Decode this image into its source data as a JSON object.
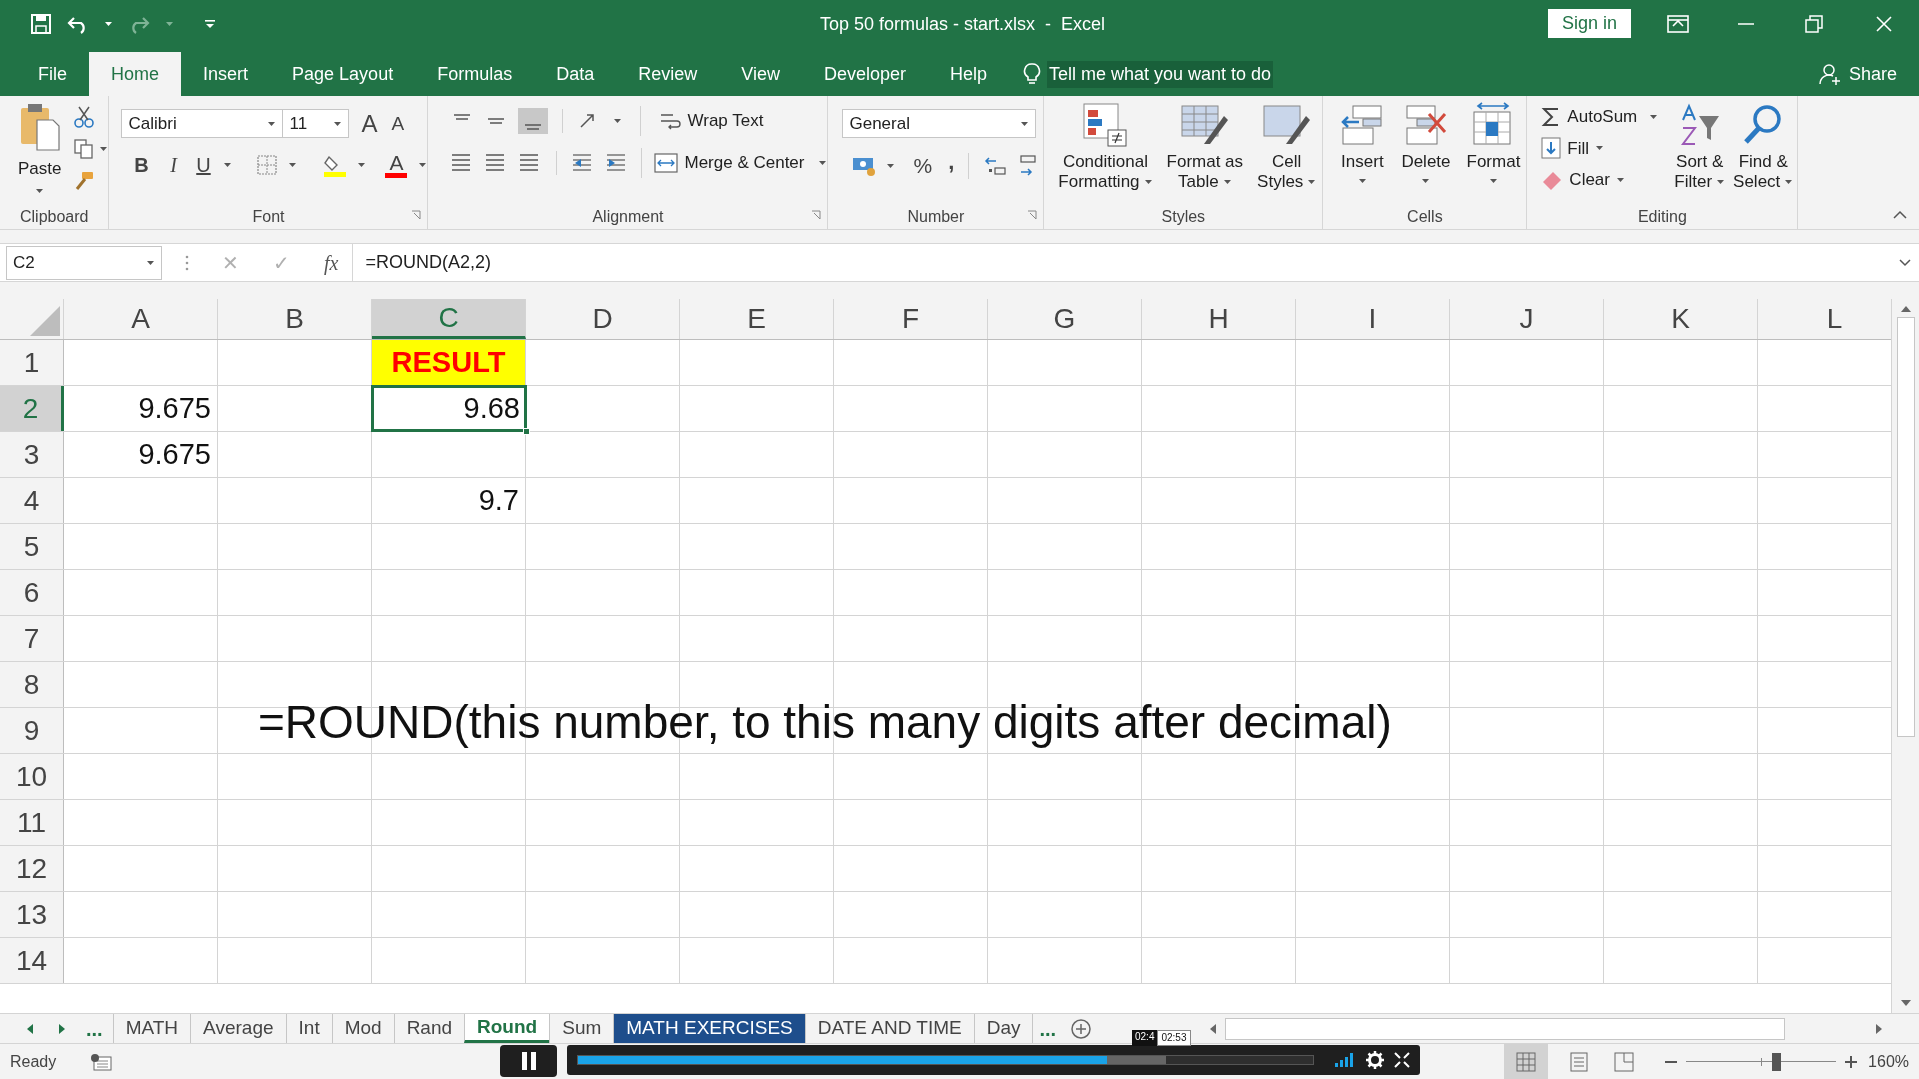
{
  "title_bar": {
    "title": "Top 50 formulas - start.xlsx  -  Excel",
    "sign_in": "Sign in"
  },
  "menu_tabs": [
    {
      "label": "File",
      "selected": false
    },
    {
      "label": "Home",
      "selected": true
    },
    {
      "label": "Insert",
      "selected": false
    },
    {
      "label": "Page Layout",
      "selected": false
    },
    {
      "label": "Formulas",
      "selected": false
    },
    {
      "label": "Data",
      "selected": false
    },
    {
      "label": "Review",
      "selected": false
    },
    {
      "label": "View",
      "selected": false
    },
    {
      "label": "Developer",
      "selected": false
    },
    {
      "label": "Help",
      "selected": false
    }
  ],
  "tell_me": "Tell me what you want to do",
  "share": "Share",
  "ribbon": {
    "clipboard": {
      "paste": "Paste",
      "label": "Clipboard"
    },
    "font": {
      "name": "Calibri",
      "size": "11",
      "grow": "A",
      "shrink": "A",
      "bold": "B",
      "italic": "I",
      "underline": "U",
      "color_letter": "A",
      "label": "Font"
    },
    "alignment": {
      "wrap_text": "Wrap Text",
      "merge": "Merge & Center",
      "label": "Alignment"
    },
    "number": {
      "format": "General",
      "percent": "%",
      "comma": ",",
      "label": "Number"
    },
    "styles": {
      "buttons": [
        {
          "lines": [
            "Conditional",
            "Formatting"
          ]
        },
        {
          "lines": [
            "Format as",
            "Table"
          ]
        },
        {
          "lines": [
            "Cell",
            "Styles"
          ]
        }
      ],
      "label": "Styles"
    },
    "cells": {
      "buttons": [
        {
          "lines": [
            "Insert"
          ]
        },
        {
          "lines": [
            "Delete"
          ]
        },
        {
          "lines": [
            "Format"
          ]
        }
      ],
      "label": "Cells"
    },
    "editing": {
      "autosum": "AutoSum",
      "fill": "Fill",
      "clear": "Clear",
      "sort": [
        "Sort &",
        "Filter"
      ],
      "find": [
        "Find &",
        "Select"
      ],
      "label": "Editing"
    }
  },
  "formula_bar": {
    "name_box": "C2",
    "cancel": "✕",
    "enter": "✓",
    "fx": "fx",
    "formula": "=ROUND(A2,2)"
  },
  "columns": [
    {
      "label": "A",
      "selected": false
    },
    {
      "label": "B",
      "selected": false
    },
    {
      "label": "C",
      "selected": true
    },
    {
      "label": "D",
      "selected": false
    },
    {
      "label": "E",
      "selected": false
    },
    {
      "label": "F",
      "selected": false
    },
    {
      "label": "G",
      "selected": false
    },
    {
      "label": "H",
      "selected": false
    },
    {
      "label": "I",
      "selected": false
    },
    {
      "label": "J",
      "selected": false
    },
    {
      "label": "K",
      "selected": false
    },
    {
      "label": "L",
      "selected": false
    }
  ],
  "rows": [
    {
      "label": "1",
      "selected": false,
      "cells": {
        "C": {
          "text": "RESULT",
          "kind": "title",
          "selected": false
        }
      }
    },
    {
      "label": "2",
      "selected": true,
      "cells": {
        "A": {
          "text": "9.675",
          "kind": "number",
          "selected": false
        },
        "C": {
          "text": "9.68",
          "kind": "number",
          "selected": true
        }
      }
    },
    {
      "label": "3",
      "selected": false,
      "cells": {
        "A": {
          "text": "9.675",
          "kind": "number",
          "selected": false
        }
      }
    },
    {
      "label": "4",
      "selected": false,
      "cells": {
        "C": {
          "text": "9.7",
          "kind": "number",
          "selected": false
        }
      }
    },
    {
      "label": "5",
      "selected": false
    },
    {
      "label": "6",
      "selected": false
    },
    {
      "label": "7",
      "selected": false
    },
    {
      "label": "8",
      "selected": false
    },
    {
      "label": "9",
      "selected": false
    },
    {
      "label": "10",
      "selected": false
    },
    {
      "label": "11",
      "selected": false
    },
    {
      "label": "12",
      "selected": false
    },
    {
      "label": "13",
      "selected": false
    },
    {
      "label": "14",
      "selected": false
    }
  ],
  "note": "=ROUND(this number, to this many digits after decimal)",
  "sheet_tabs": {
    "more_left": "...",
    "more_right": "...",
    "tabs": [
      {
        "label": "MATH",
        "selected": false
      },
      {
        "label": "Average",
        "selected": false
      },
      {
        "label": "Int",
        "selected": false
      },
      {
        "label": "Mod",
        "selected": false
      },
      {
        "label": "Rand",
        "selected": false
      },
      {
        "label": "Round",
        "selected": true
      },
      {
        "label": "Sum",
        "selected": false
      },
      {
        "label": "MATH EXERCISES",
        "selected": false,
        "color": "#1e4e8c"
      },
      {
        "label": "DATE AND TIME",
        "selected": false
      },
      {
        "label": "Day",
        "selected": false
      }
    ]
  },
  "video_player": {
    "played": {
      "level": 0.72
    },
    "buffered": {
      "level": 0.8
    },
    "times": [
      "02:4",
      "02:53"
    ]
  },
  "status_bar": {
    "status": "Ready",
    "zoom": "160%",
    "zoom_slider": {
      "level": 0.6
    }
  }
}
